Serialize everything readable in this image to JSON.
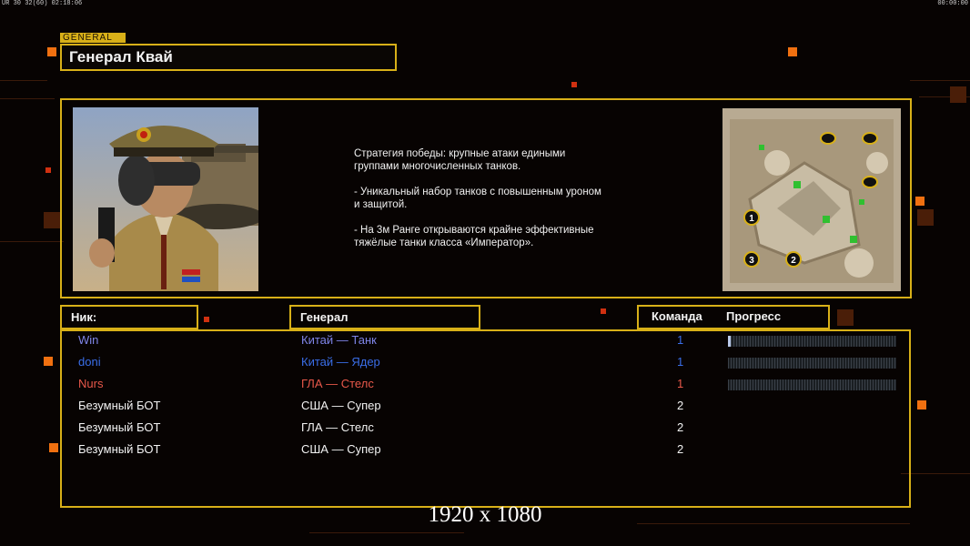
{
  "hud": {
    "left": "UR 30 32(60) 02:18:06",
    "right": "00:00:00"
  },
  "tag": "GENERAL",
  "title": "Генерал Квай",
  "description": [
    "Стратегия победы: крупные атаки едиными\n группами многочисленных танков.",
    "- Уникальный набор танков с повышенным уроном\n и защитой.",
    "- На 3м Ранге открываются крайне эффективные\n тяжёлые танки класса «Император»."
  ],
  "headers": {
    "nick": "Ник:",
    "general": "Генерал",
    "team": "Команда",
    "progress": "Прогресс"
  },
  "players": [
    {
      "nick": "Win",
      "general": "Китай — Танк",
      "team": "1",
      "color": "#7f85e8",
      "progress": 0.01,
      "show_progress": true
    },
    {
      "nick": "doni",
      "general": "Китай — Ядер",
      "team": "1",
      "color": "#3a6ee8",
      "progress": 0.0,
      "show_progress": true
    },
    {
      "nick": "Nurs",
      "general": "ГЛА — Стелс",
      "team": "1",
      "color": "#e8584a",
      "progress": 0.0,
      "show_progress": true
    },
    {
      "nick": "Безумный БОТ",
      "general": "США — Супер",
      "team": "2",
      "color": "#f2f2f2",
      "show_progress": false
    },
    {
      "nick": "Безумный БОТ",
      "general": "ГЛА — Стелс",
      "team": "2",
      "color": "#f2f2f2",
      "show_progress": false
    },
    {
      "nick": "Безумный БОТ",
      "general": "США — Супер",
      "team": "2",
      "color": "#f2f2f2",
      "show_progress": false
    }
  ],
  "general_colors": [
    "#7f85e8",
    "#3a6ee8",
    "#e8584a",
    "#f2f2f2",
    "#f2f2f2",
    "#f2f2f2"
  ],
  "team_colors": [
    "#3a6ee8",
    "#3a6ee8",
    "#e8584a",
    "#f2f2f2",
    "#f2f2f2",
    "#f2f2f2"
  ],
  "minimap": {
    "start_labels": [
      "1",
      "2",
      "3"
    ]
  },
  "resolution": "1920 x 1080"
}
